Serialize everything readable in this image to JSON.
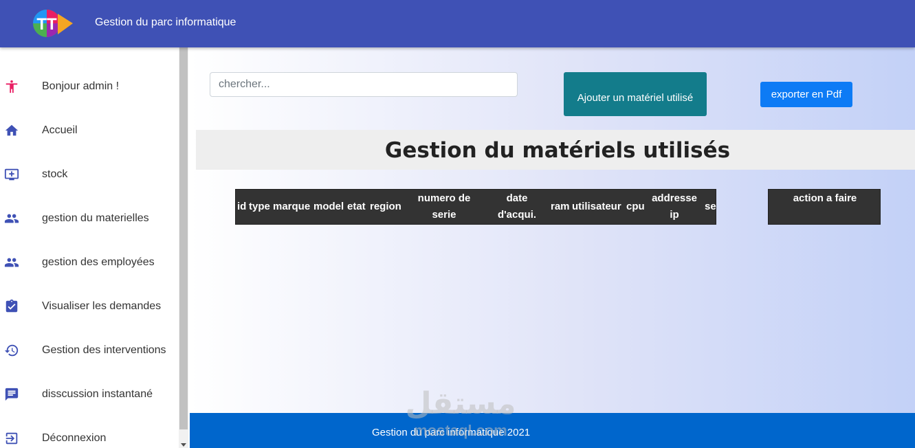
{
  "header": {
    "app_title": "Gestion du parc informatique",
    "logo_text": "TT"
  },
  "sidebar": {
    "items": [
      {
        "label": "Bonjour admin !",
        "icon": "person-icon"
      },
      {
        "label": "Accueil",
        "icon": "home-icon"
      },
      {
        "label": "stock",
        "icon": "monitor-add-icon"
      },
      {
        "label": "gestion du materielles",
        "icon": "people-icon"
      },
      {
        "label": "gestion des employées",
        "icon": "people-icon"
      },
      {
        "label": "Visualiser les demandes",
        "icon": "clipboard-check-icon"
      },
      {
        "label": "Gestion des interventions",
        "icon": "history-icon"
      },
      {
        "label": "disscussion instantané",
        "icon": "chat-icon"
      },
      {
        "label": "Déconnexion",
        "icon": "logout-icon"
      }
    ]
  },
  "toolbar": {
    "search_placeholder": "chercher...",
    "add_label": "Ajouter un matériel utilisé",
    "pdf_label": "exporter en Pdf"
  },
  "page": {
    "title": "Gestion du matériels utilisés"
  },
  "table": {
    "columns": [
      "id",
      "type",
      "marque",
      "model",
      "etat",
      "region",
      "numero de serie",
      "date d'acqui.",
      "ram",
      "utilisateur",
      "cpu",
      "addresse ip",
      "se"
    ],
    "action_header": "action a faire"
  },
  "footer": {
    "text": "Gestion du parc informatique 2021"
  },
  "watermark": {
    "arabic": "مستقل",
    "latin": "mostaql.com"
  },
  "colors": {
    "topbar": "#3f51b5",
    "icon": "#3f51b5",
    "person_icon": "#e91e63",
    "add_button": "#137c8b",
    "pdf_button": "#0d7bf5",
    "footer": "#0066cc",
    "table_header": "#333333"
  }
}
